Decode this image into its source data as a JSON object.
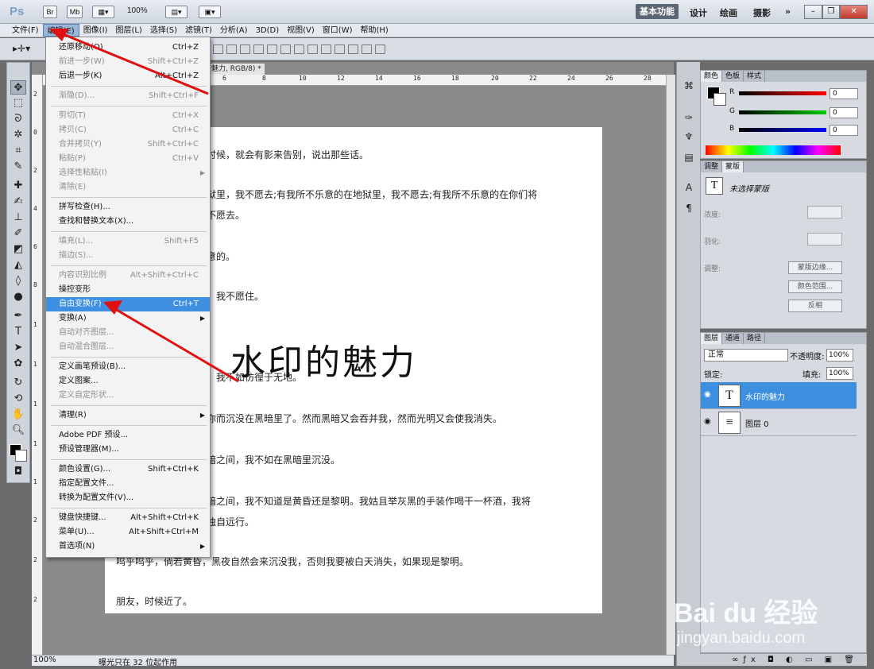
{
  "app": {
    "logo": "Ps",
    "bridge": "Br",
    "minibridge": "Mb",
    "zoom": "100%",
    "workspace_active": "基本功能",
    "workspaces": [
      "设计",
      "绘画",
      "摄影",
      "»"
    ]
  },
  "menu": [
    "文件(F)",
    "编辑(E)",
    "图像(I)",
    "图层(L)",
    "选择(S)",
    "滤镜(T)",
    "分析(A)",
    "3D(D)",
    "视图(V)",
    "窗口(W)",
    "帮助(H)"
  ],
  "document": {
    "tab_title": "魅力, RGB/8) *",
    "ruler_top": [
      "6",
      "8",
      "10",
      "12",
      "14",
      "16",
      "18",
      "20",
      "22",
      "24",
      "26",
      "28"
    ],
    "ruler_left": [
      "2",
      "0",
      "2",
      "4",
      "6",
      "8",
      "1",
      "1",
      "1",
      "1",
      "1",
      "2",
      "2",
      "2"
    ],
    "watermark": "水印的魅力",
    "lines": [
      "时候，就会有影来告别，说出那些话。",
      "狱里，我不愿去;有我所不乐意的在地狱里，我不愿去;有我所不乐意的在你们将",
      "不愿去。",
      "意的。",
      "，我不愿住。",
      "，我不如彷徨于无地。",
      "你而沉没在黑暗里了。然而黑暗又会吞并我，然而光明又会使我消失。",
      "暗之间，我不如在黑暗里沉没。",
      "暗之间，我不知道是黄昏还是黎明。我姑且举灰黑的手装作喝干一杯酒，我将",
      "独自远行。",
      "呜乎呜乎，倘若黄昏，黑夜自然会来沉没我，否则我要被白天消失，如果现是黎明。",
      "朋友，时候近了。"
    ]
  },
  "edit_menu": {
    "items": [
      {
        "label": "还原移动(O)",
        "shortcut": "Ctrl+Z",
        "disabled": false
      },
      {
        "label": "前进一步(W)",
        "shortcut": "Shift+Ctrl+Z",
        "disabled": true
      },
      {
        "label": "后退一步(K)",
        "shortcut": "Alt+Ctrl+Z",
        "disabled": false
      },
      {
        "label": "渐隐(D)...",
        "shortcut": "Shift+Ctrl+F",
        "disabled": true
      },
      {
        "label": "剪切(T)",
        "shortcut": "Ctrl+X",
        "disabled": true
      },
      {
        "label": "拷贝(C)",
        "shortcut": "Ctrl+C",
        "disabled": true
      },
      {
        "label": "合并拷贝(Y)",
        "shortcut": "Shift+Ctrl+C",
        "disabled": true
      },
      {
        "label": "粘贴(P)",
        "shortcut": "Ctrl+V",
        "disabled": true
      },
      {
        "label": "选择性粘贴(I)",
        "shortcut": "",
        "disabled": true
      },
      {
        "label": "清除(E)",
        "shortcut": "",
        "disabled": true
      },
      {
        "label": "拼写检查(H)...",
        "shortcut": "",
        "disabled": false
      },
      {
        "label": "查找和替换文本(X)...",
        "shortcut": "",
        "disabled": false
      },
      {
        "label": "填充(L)...",
        "shortcut": "Shift+F5",
        "disabled": true
      },
      {
        "label": "描边(S)...",
        "shortcut": "",
        "disabled": true
      },
      {
        "label": "内容识别比例",
        "shortcut": "Alt+Shift+Ctrl+C",
        "disabled": true
      },
      {
        "label": "操控变形",
        "shortcut": "",
        "disabled": false
      },
      {
        "label": "自由变换(F)",
        "shortcut": "Ctrl+T",
        "disabled": false
      },
      {
        "label": "变换(A)",
        "shortcut": "",
        "disabled": false
      },
      {
        "label": "自动对齐图层...",
        "shortcut": "",
        "disabled": true
      },
      {
        "label": "自动混合图层...",
        "shortcut": "",
        "disabled": true
      },
      {
        "label": "定义画笔预设(B)...",
        "shortcut": "",
        "disabled": false
      },
      {
        "label": "定义图案...",
        "shortcut": "",
        "disabled": false
      },
      {
        "label": "定义自定形状...",
        "shortcut": "",
        "disabled": true
      },
      {
        "label": "清理(R)",
        "shortcut": "",
        "disabled": false
      },
      {
        "label": "Adobe PDF 预设...",
        "shortcut": "",
        "disabled": false
      },
      {
        "label": "预设管理器(M)...",
        "shortcut": "",
        "disabled": false
      },
      {
        "label": "颜色设置(G)...",
        "shortcut": "Shift+Ctrl+K",
        "disabled": false
      },
      {
        "label": "指定配置文件...",
        "shortcut": "",
        "disabled": false
      },
      {
        "label": "转换为配置文件(V)...",
        "shortcut": "",
        "disabled": false
      },
      {
        "label": "键盘快捷键...",
        "shortcut": "Alt+Shift+Ctrl+K",
        "disabled": false
      },
      {
        "label": "菜单(U)...",
        "shortcut": "Alt+Shift+Ctrl+M",
        "disabled": false
      },
      {
        "label": "首选项(N)",
        "shortcut": "",
        "disabled": false
      }
    ]
  },
  "color_panel": {
    "tabs": [
      "颜色",
      "色板",
      "样式"
    ],
    "r_label": "R",
    "g_label": "G",
    "b_label": "B",
    "r": "0",
    "g": "0",
    "b": "0"
  },
  "mask_panel": {
    "tabs": [
      "调整",
      "蒙版"
    ],
    "title": "未选择蒙版",
    "density": "浓度:",
    "feather": "羽化:",
    "adjust": "调整:",
    "btn_edge": "蒙版边缘...",
    "btn_range": "颜色范围...",
    "btn_invert": "反相"
  },
  "layers_panel": {
    "tabs": [
      "图层",
      "通道",
      "路径"
    ],
    "mode": "正常",
    "opacity_label": "不透明度:",
    "opacity": "100%",
    "lock_label": "锁定:",
    "fill_label": "填充:",
    "fill": "100%",
    "layers": [
      {
        "name": "水印的魅力"
      },
      {
        "name": "图层 0"
      }
    ]
  },
  "status": {
    "zoom": "100%",
    "info": "曝光只在 32 位起作用"
  },
  "watermark_brand": {
    "logo": "Bai du 经验",
    "url": "jingyan.baidu.com"
  },
  "colors": {
    "arrow": "#e01010",
    "highlight": "#3f8fe1"
  }
}
